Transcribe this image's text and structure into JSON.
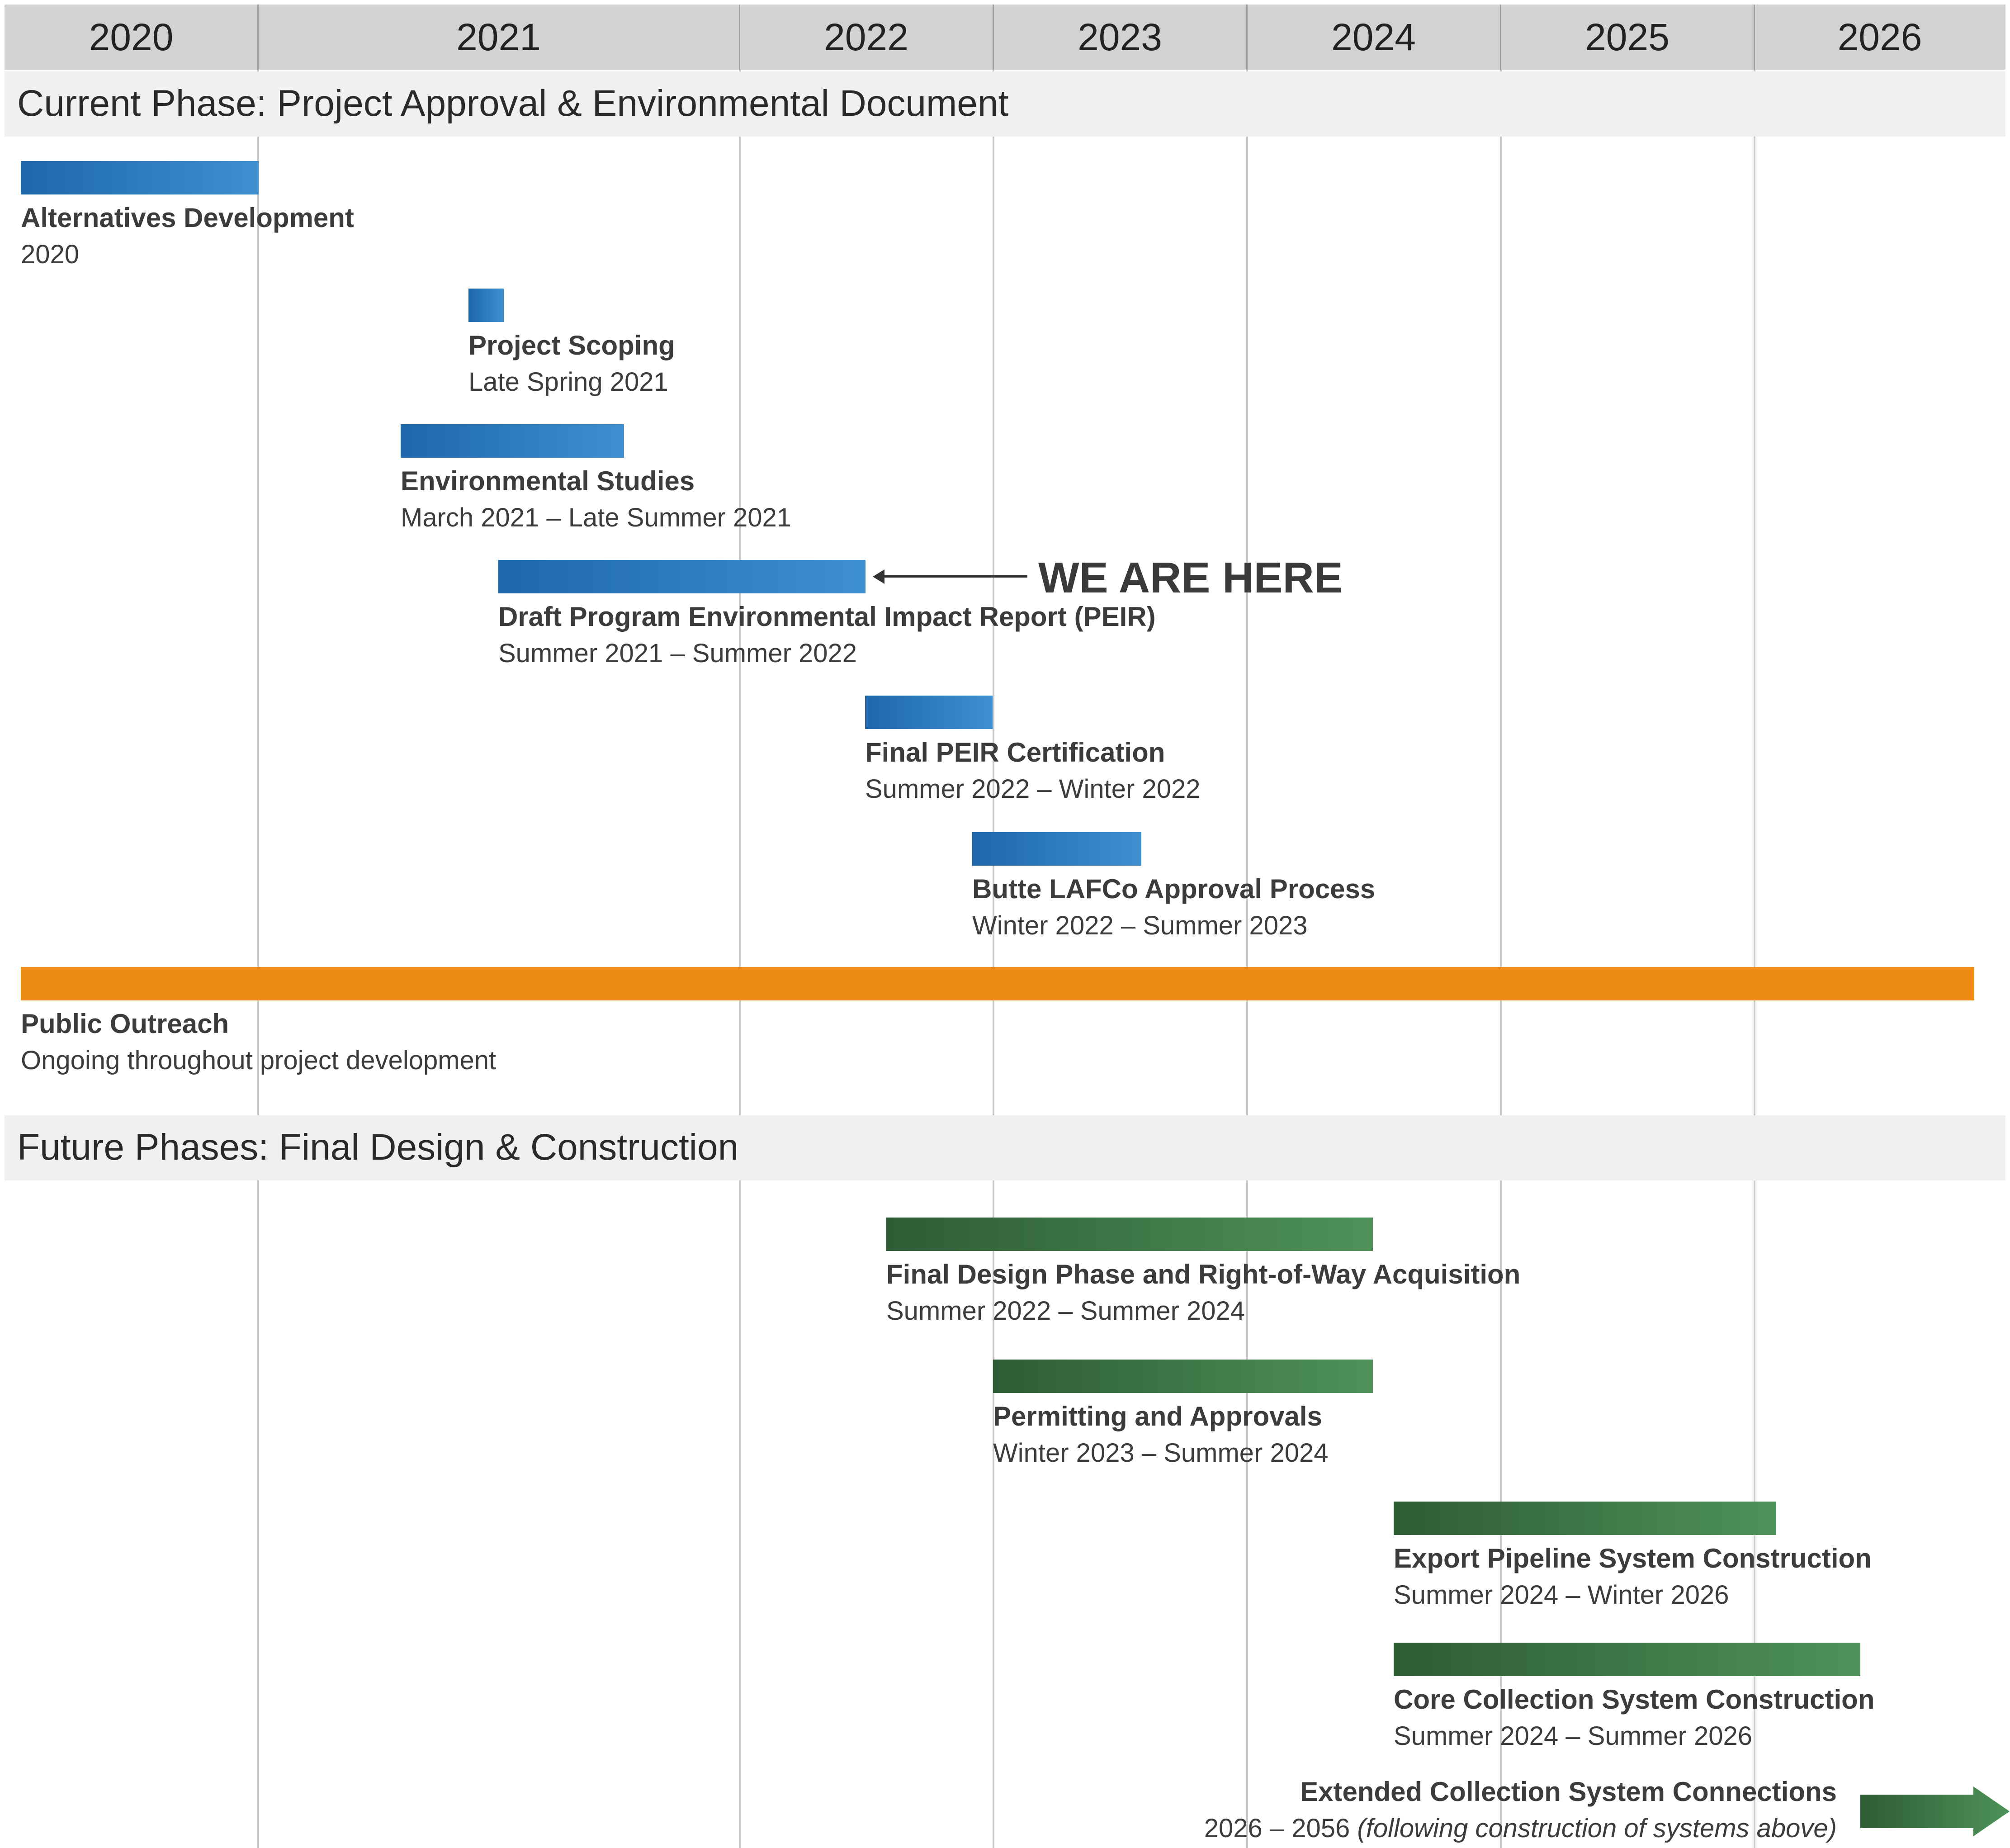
{
  "timeline": {
    "years": [
      "2020",
      "2021",
      "2022",
      "2023",
      "2024",
      "2025",
      "2026"
    ],
    "colors": {
      "current_phase": "#2f7cc4",
      "public_outreach": "#ee8a16",
      "future_phase": "#3d7a47",
      "header": "#d2d2d2",
      "band": "#f0f0f0"
    },
    "current_phase": {
      "title": "Current Phase: Project Approval & Environmental Document",
      "tasks": [
        {
          "name": "Alternatives Development",
          "dates": "2020",
          "start": 2020.0,
          "end": 2021.0
        },
        {
          "name": "Project Scoping",
          "dates": "Late Spring 2021",
          "start": 2021.45,
          "end": 2021.52
        },
        {
          "name": "Environmental Studies",
          "dates": "March 2021 – Late Summer 2021",
          "start": 2021.3,
          "end": 2021.77
        },
        {
          "name": "Draft Program Environmental Impact Report (PEIR)",
          "dates": "Summer 2021 – Summer 2022",
          "start": 2021.5,
          "end": 2022.5
        },
        {
          "name": "Final PEIR Certification",
          "dates": "Summer 2022 – Winter 2022",
          "start": 2022.5,
          "end": 2023.0
        },
        {
          "name": "Butte LAFCo Approval Process",
          "dates": "Winter 2022 – Summer 2023",
          "start": 2022.92,
          "end": 2023.58
        }
      ],
      "we_are_here": "WE ARE HERE",
      "public_outreach": {
        "name": "Public Outreach",
        "dates": "Ongoing throughout project development",
        "start": 2020.0,
        "end": 2026.87
      }
    },
    "future_phases": {
      "title": "Future Phases: Final Design & Construction",
      "tasks": [
        {
          "name": "Final Design Phase and Right-of-Way Acquisition",
          "dates": "Summer 2022 – Summer 2024",
          "start": 2022.58,
          "end": 2024.5
        },
        {
          "name": "Permitting and Approvals",
          "dates": "Winter 2023 – Summer 2024",
          "start": 2023.0,
          "end": 2024.5
        },
        {
          "name": "Export Pipeline System Construction",
          "dates": "Summer 2024 – Winter 2026",
          "start": 2024.58,
          "end": 2026.08
        },
        {
          "name": "Core Collection System Construction",
          "dates": "Summer 2024 – Summer 2026",
          "start": 2024.58,
          "end": 2026.42
        }
      ],
      "extended": {
        "name": "Extended Collection System Connections",
        "dates": "2026 – 2056",
        "note": "(following construction of systems above)"
      }
    }
  }
}
